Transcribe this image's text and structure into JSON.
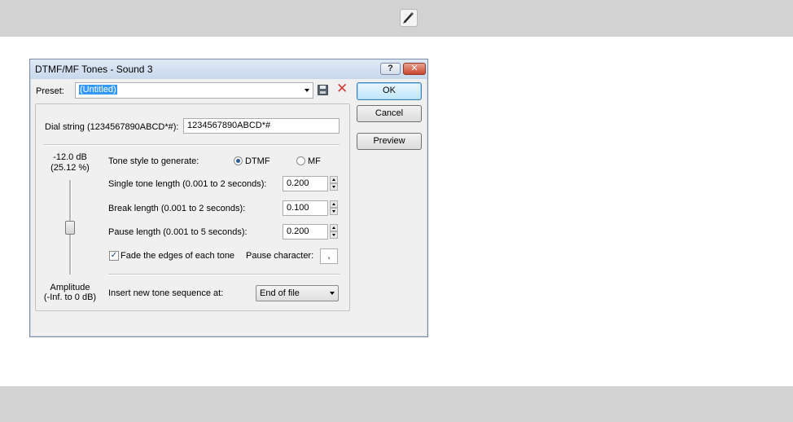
{
  "app": {
    "top_tool_icon": "pencil-edit-icon"
  },
  "dialog": {
    "title": "DTMF/MF Tones - Sound 3",
    "help_label": "?",
    "close_label": "✕",
    "preset_label": "Preset:",
    "preset_value": "(Untitled)",
    "delete_glyph": "✕",
    "ok_label": "OK",
    "cancel_label": "Cancel",
    "preview_label": "Preview",
    "dial_label": "Dial string (1234567890ABCD*#):",
    "dial_value": "1234567890ABCD*#",
    "amp_db": "-12.0 dB",
    "amp_pct": "(25.12 %)",
    "amp_label": "Amplitude",
    "amp_range": "(-Inf. to 0 dB)",
    "amplitude_level_percent": 25.12,
    "tone_style_label": "Tone style to generate:",
    "tone_dtmf": "DTMF",
    "tone_mf": "MF",
    "tone_selected": "DTMF",
    "single_len_label": "Single tone length (0.001 to 2 seconds):",
    "single_len_value": "0.200",
    "break_len_label": "Break length (0.001 to 2 seconds):",
    "break_len_value": "0.100",
    "pause_len_label": "Pause length (0.001 to 5 seconds):",
    "pause_len_value": "0.200",
    "fade_label": "Fade the edges of each tone",
    "fade_checked": true,
    "check_glyph": "✓",
    "pause_char_label": "Pause character:",
    "pause_char_value": ",",
    "insert_label": "Insert new tone sequence at:",
    "insert_value": "End of file"
  }
}
